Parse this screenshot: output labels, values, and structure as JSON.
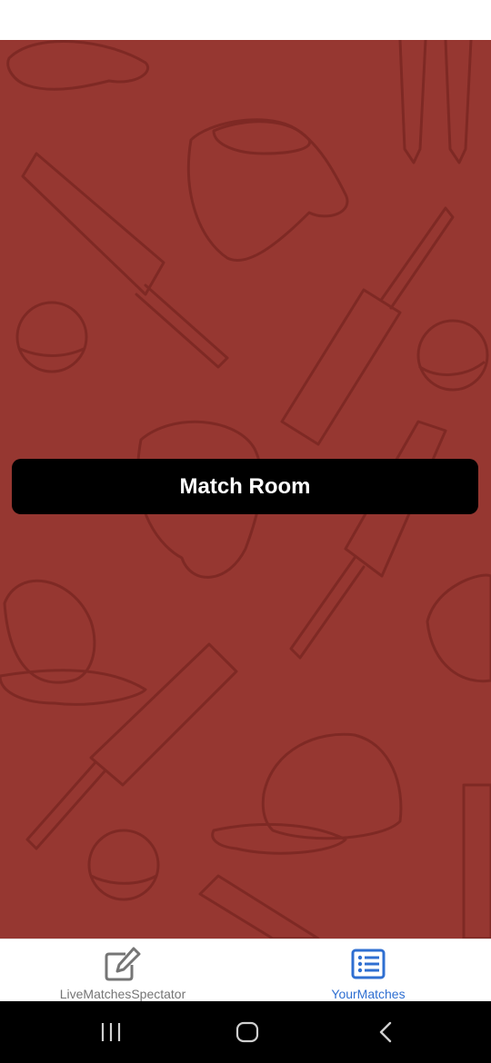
{
  "main": {
    "background_color": "#963731",
    "match_room_button_label": "Match Room"
  },
  "bottom_nav": {
    "tabs": [
      {
        "label": "LiveMatchesSpectator",
        "icon": "edit-icon",
        "active": false,
        "color": "#757575"
      },
      {
        "label": "YourMatches",
        "icon": "list-icon",
        "active": true,
        "color": "#2f6fd1"
      }
    ]
  },
  "system_nav": {
    "buttons": [
      "recent-apps-icon",
      "home-icon",
      "back-icon"
    ]
  }
}
